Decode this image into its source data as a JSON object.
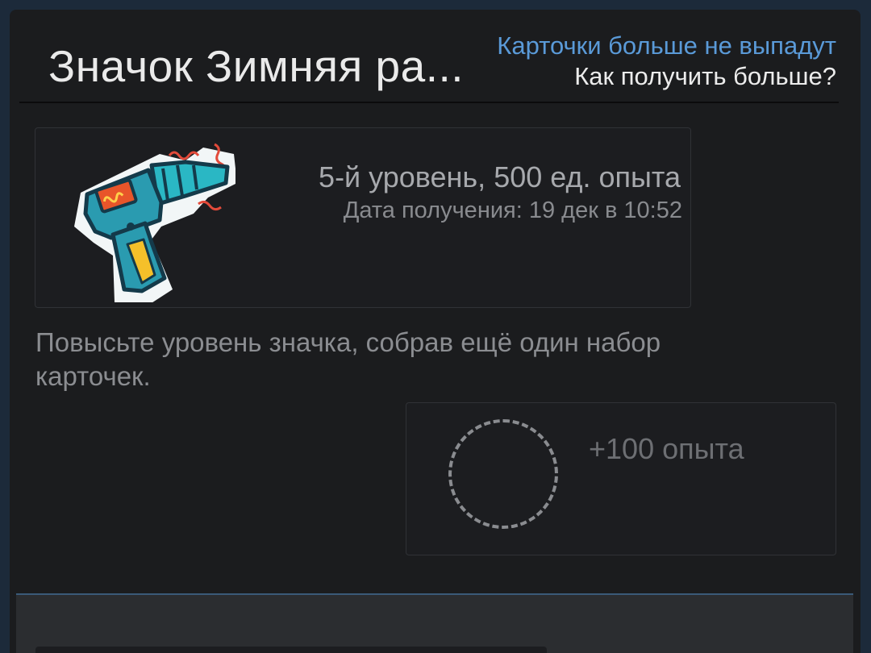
{
  "header": {
    "title": "Значок Зимняя ра...",
    "no_more_cards": "Карточки больше не выпадут",
    "how_to_get_more": "Как получить больше?"
  },
  "badge": {
    "image_icon": "raygun-badge-icon",
    "level_text": "5-й уровень, 500 ед. опыта",
    "date_text": "Дата получения: 19 дек в 10:52"
  },
  "level_up": {
    "text": "Повысьте уровень значка, собрав ещё один набор карточек."
  },
  "next_level": {
    "icon": "dashed-circle-placeholder-icon",
    "xp_text": "+100 опыта"
  },
  "colors": {
    "background": "#1b1c1e",
    "accent_link": "#5a9ad8",
    "outer_background": "#1c2a3a"
  }
}
